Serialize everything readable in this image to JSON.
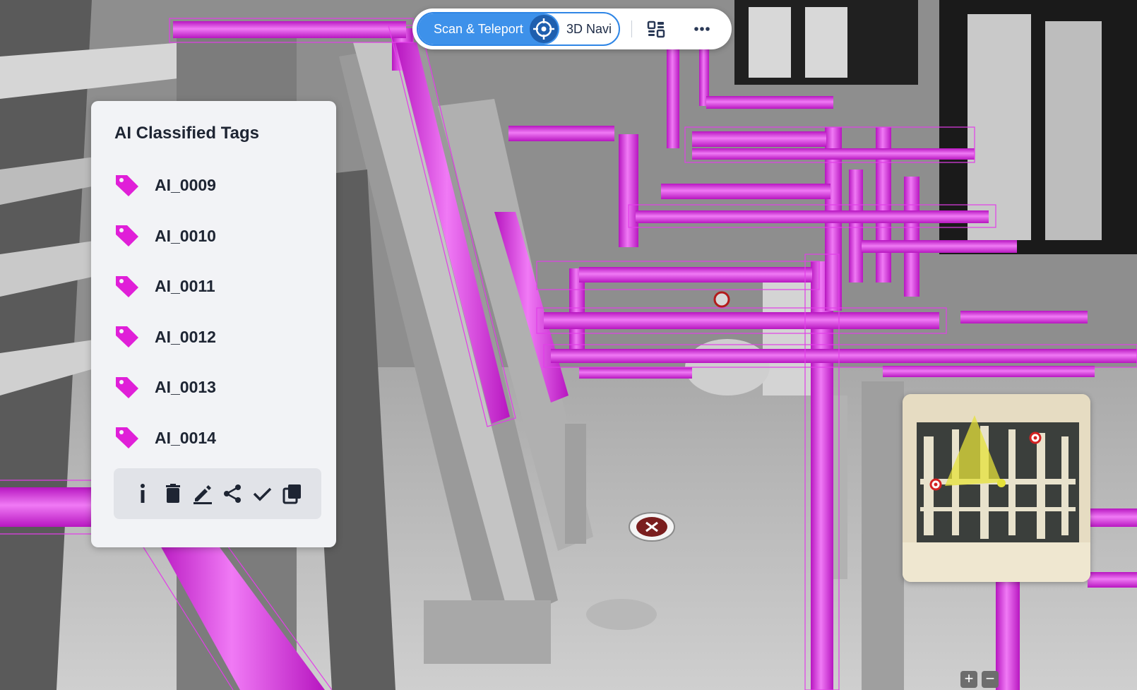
{
  "topbar": {
    "mode_active_label": "Scan & Teleport",
    "mode_other_label": "3D Navi"
  },
  "tags_panel": {
    "title": "AI Classified Tags",
    "items": [
      {
        "label": "AI_0009"
      },
      {
        "label": "AI_0010"
      },
      {
        "label": "AI_0011"
      },
      {
        "label": "AI_0012"
      },
      {
        "label": "AI_0013"
      },
      {
        "label": "AI_0014"
      }
    ],
    "toolbar": [
      "info-icon",
      "delete-icon",
      "edit-icon",
      "share-icon",
      "check-icon",
      "copy-icon"
    ]
  },
  "colors": {
    "pipe_magenta": "#e23ee8",
    "accent_blue": "#3d91ea",
    "tag_icon": "#e01fd8"
  },
  "zoom": {
    "in_label": "+",
    "out_label": "−"
  }
}
